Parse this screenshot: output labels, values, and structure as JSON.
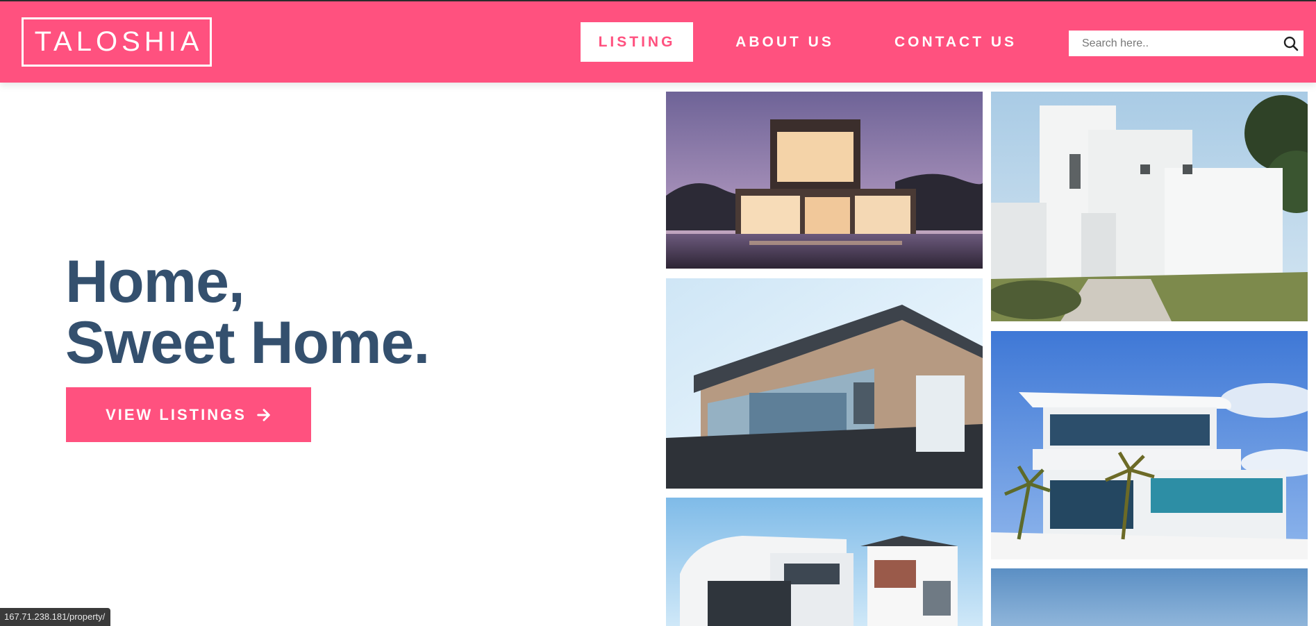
{
  "brand": {
    "logo_text": "TALOSHIA",
    "accent_color": "#ff517f",
    "heading_color": "#34506e"
  },
  "nav": {
    "listing_label": "LISTING",
    "about_label": "ABOUT US",
    "contact_label": "CONTACT US",
    "active": "LISTING"
  },
  "search": {
    "placeholder": "Search here..",
    "value": "",
    "icon": "search-icon"
  },
  "hero": {
    "title_line1": "Home,",
    "title_line2": "Sweet Home.",
    "cta_label": "VIEW LISTINGS",
    "cta_icon": "arrow-right-icon"
  },
  "gallery": {
    "images": [
      "modern-house-at-dusk-with-pool",
      "white-cubic-house",
      "house-with-wooden-cladding-and-glass-balcony",
      "white-house-with-curved-roof-and-palm-trees",
      "white-apartment-building",
      "sky-photo"
    ]
  },
  "status_bar": {
    "url": "167.71.238.181/property/"
  }
}
